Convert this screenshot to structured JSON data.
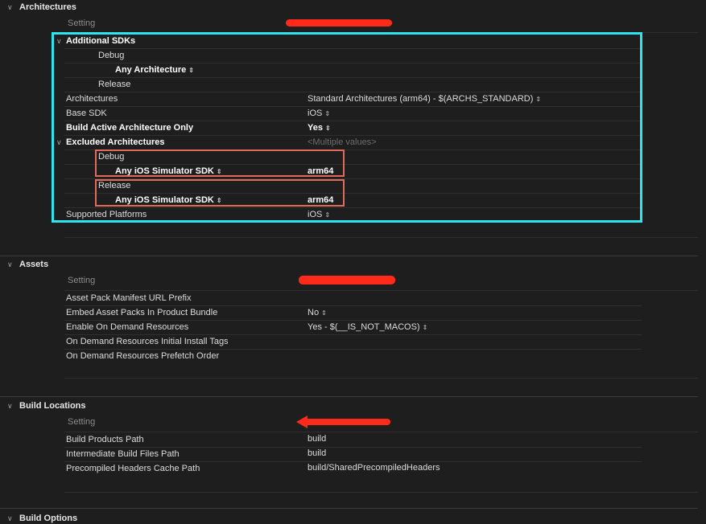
{
  "sections": {
    "architectures": {
      "title": "Architectures",
      "header_col": "Setting",
      "additional_sdks": {
        "label": "Additional SDKs",
        "debug": "Debug",
        "debug_value": "Any Architecture",
        "release": "Release"
      },
      "architectures": {
        "label": "Architectures",
        "value": "Standard Architectures (arm64)  -  $(ARCHS_STANDARD)"
      },
      "base_sdk": {
        "label": "Base SDK",
        "value": "iOS"
      },
      "build_active": {
        "label": "Build Active Architecture Only",
        "value": "Yes"
      },
      "excluded": {
        "label": "Excluded Architectures",
        "value": "<Multiple values>",
        "debug": "Debug",
        "debug_sdk": "Any iOS Simulator SDK",
        "debug_value": "arm64",
        "release": "Release",
        "release_sdk": "Any iOS Simulator SDK",
        "release_value": "arm64"
      },
      "supported_platforms": {
        "label": "Supported Platforms",
        "value": "iOS"
      }
    },
    "assets": {
      "title": "Assets",
      "header_col": "Setting",
      "rows": [
        {
          "label": "Asset Pack Manifest URL Prefix",
          "value": ""
        },
        {
          "label": "Embed Asset Packs In Product Bundle",
          "value": "No"
        },
        {
          "label": "Enable On Demand Resources",
          "value": "Yes  -  $(__IS_NOT_MACOS)"
        },
        {
          "label": "On Demand Resources Initial Install Tags",
          "value": ""
        },
        {
          "label": "On Demand Resources Prefetch Order",
          "value": ""
        }
      ]
    },
    "build_locations": {
      "title": "Build Locations",
      "header_col": "Setting",
      "rows": [
        {
          "label": "Build Products Path",
          "value": "build"
        },
        {
          "label": "Intermediate Build Files Path",
          "value": "build"
        },
        {
          "label": "Precompiled Headers Cache Path",
          "value": "build/SharedPrecompiledHeaders"
        }
      ]
    },
    "build_options": {
      "title": "Build Options"
    }
  },
  "icons": {
    "expand": "chevron-down-icon",
    "stepper": "up-down-stepper-icon"
  },
  "colors": {
    "background": "#1e1e1e",
    "highlight_box": "#2fe6f0",
    "callout_box": "#e06a5c",
    "redaction": "#ff2a1a"
  }
}
